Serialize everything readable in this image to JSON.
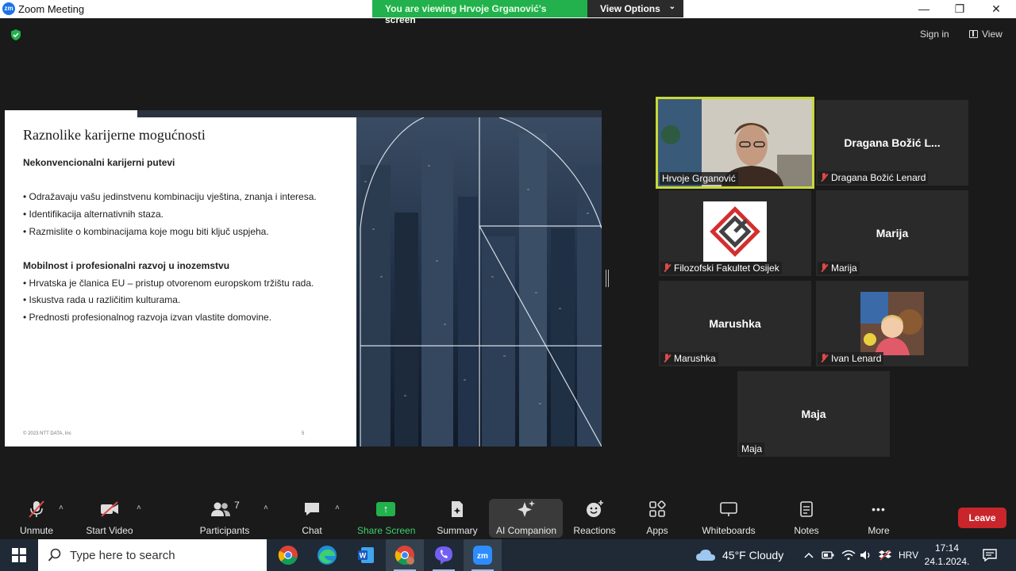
{
  "window": {
    "app_title": "Zoom Meeting",
    "app_icon_text": "zm",
    "minimize": "—",
    "restore": "❐",
    "close": "✕"
  },
  "banner": {
    "viewing_text": "You are viewing Hrvoje Grganović's screen",
    "view_options": "View Options"
  },
  "header": {
    "sign_in": "Sign in",
    "view": "View"
  },
  "slide": {
    "title": "Raznolike karijerne mogućnosti",
    "section1_heading": "Nekonvencionalni karijerni putevi",
    "section1_bullets": [
      "• Odražavaju vašu jedinstvenu kombinaciju vještina, znanja i interesa.",
      "• Identifikacija alternativnih staza.",
      "• Razmislite o kombinacijama koje mogu biti ključ uspjeha."
    ],
    "section2_heading": "Mobilnost i profesionalni razvoj u inozemstvu",
    "section2_bullets": [
      "•    Hrvatska je članica EU – pristup otvorenom europskom tržištu rada.",
      "•    Iskustva rada u različitim kulturama.",
      "•    Prednosti profesionalnog razvoja izvan vlastite domovine."
    ],
    "footer": "© 2023 NTT DATA, Inc",
    "page_number": "5"
  },
  "participants_tiles": [
    {
      "name": "Hrvoje Grganović",
      "center": "",
      "muted": false,
      "video": true
    },
    {
      "name": "Dragana Božić Lenard",
      "center": "Dragana Božić L...",
      "muted": true,
      "video": false
    },
    {
      "name": "Filozofski Fakultet Osijek",
      "center": "",
      "muted": true,
      "video": true
    },
    {
      "name": "Marija",
      "center": "Marija",
      "muted": true,
      "video": false
    },
    {
      "name": "Marushka",
      "center": "Marushka",
      "muted": true,
      "video": false
    },
    {
      "name": "Ivan Lenard",
      "center": "",
      "muted": true,
      "video": true
    },
    {
      "name": "Maja",
      "center": "Maja",
      "muted": false,
      "video": false
    }
  ],
  "toolbar": {
    "unmute": "Unmute",
    "start_video": "Start Video",
    "participants": "Participants",
    "participants_count": "7",
    "chat": "Chat",
    "share_screen": "Share Screen",
    "summary": "Summary",
    "ai_companion": "AI Companion",
    "reactions": "Reactions",
    "apps": "Apps",
    "whiteboards": "Whiteboards",
    "notes": "Notes",
    "more": "More",
    "more_icon": "•••",
    "caret": "˄",
    "leave": "Leave"
  },
  "taskbar": {
    "search_placeholder": "Type here to search",
    "weather": "45°F  Cloudy",
    "language": "HRV",
    "time": "17:14",
    "date": "24.1.2024.",
    "apps": [
      "chrome-icon",
      "edge-icon",
      "word-icon",
      "chrome-profile-icon",
      "viber-icon",
      "zoom-icon"
    ]
  },
  "colors": {
    "accent_green": "#22b14c",
    "leave_red": "#c9252b",
    "active_speaker": "#c8d93a",
    "muted_red": "#e04848"
  }
}
